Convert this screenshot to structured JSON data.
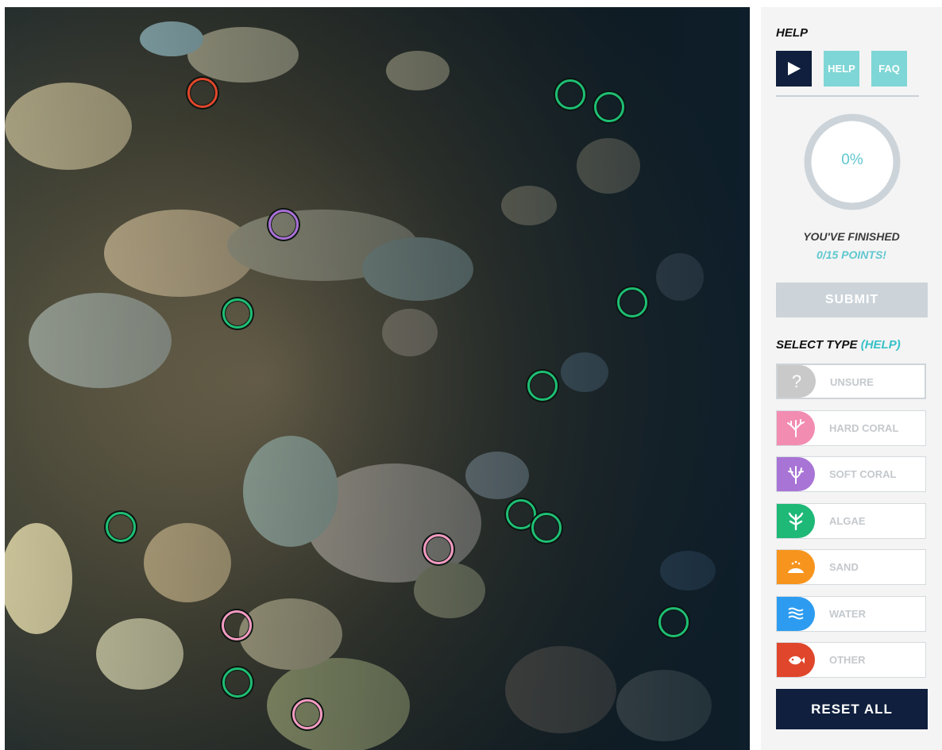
{
  "help": {
    "title": "HELP",
    "play_icon": "play-icon",
    "help_button": "HELP",
    "faq_button": "FAQ"
  },
  "progress": {
    "percent_text": "0%",
    "fraction": 0,
    "finished_label": "YOU'VE FINISHED",
    "points_label": "0/15 POINTS!"
  },
  "submit_label": "SUBMIT",
  "select_type": {
    "title": "SELECT TYPE",
    "help_link": "(HELP)",
    "types": [
      {
        "label": "UNSURE",
        "icon": "question-icon",
        "color": "#c9c9c9"
      },
      {
        "label": "HARD CORAL",
        "icon": "hard-coral-icon",
        "color": "#f28cb1"
      },
      {
        "label": "SOFT CORAL",
        "icon": "soft-coral-icon",
        "color": "#a874d6"
      },
      {
        "label": "ALGAE",
        "icon": "algae-icon",
        "color": "#1eb877"
      },
      {
        "label": "SAND",
        "icon": "sand-icon",
        "color": "#f7941d"
      },
      {
        "label": "WATER",
        "icon": "water-icon",
        "color": "#2d9cf0"
      },
      {
        "label": "OTHER",
        "icon": "fish-icon",
        "color": "#e0462b"
      }
    ]
  },
  "reset_label": "RESET ALL",
  "point_colors": {
    "algae": "#1ebe73",
    "hard_coral": "#f49ac1",
    "soft_coral": "#a96fd6",
    "other": "#e0462b"
  },
  "annotation_points": [
    {
      "type": "other"
    },
    {
      "type": "algae"
    },
    {
      "type": "algae"
    },
    {
      "type": "soft_coral"
    },
    {
      "type": "algae"
    },
    {
      "type": "algae"
    },
    {
      "type": "algae"
    },
    {
      "type": "algae"
    },
    {
      "type": "algae"
    },
    {
      "type": "algae"
    },
    {
      "type": "hard_coral"
    },
    {
      "type": "algae"
    },
    {
      "type": "hard_coral"
    },
    {
      "type": "algae"
    },
    {
      "type": "hard_coral"
    }
  ]
}
